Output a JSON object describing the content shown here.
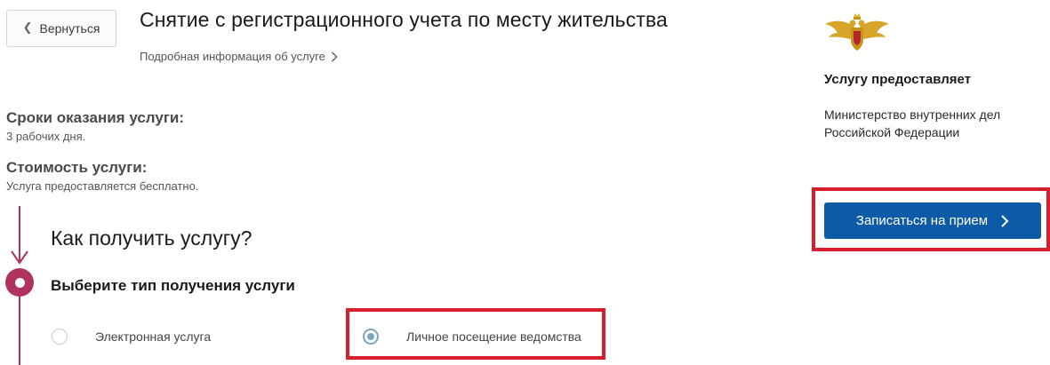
{
  "header": {
    "back_label": "Вернуться",
    "title": "Снятие с регистрационного учета по месту жительства",
    "info_link": "Подробная информация об услуге"
  },
  "terms": {
    "label": "Сроки оказания услуги:",
    "value": "3 рабочих дня."
  },
  "cost": {
    "label": "Стоимость услуги:",
    "value": "Услуга предоставляется бесплатно."
  },
  "how": {
    "title": "Как получить услугу?",
    "step_label": "Выберите тип получения услуги",
    "options": [
      {
        "label": "Электронная услуга",
        "selected": false
      },
      {
        "label": "Личное посещение ведомства",
        "selected": true
      }
    ]
  },
  "provider": {
    "emblem_icon": "russian-double-headed-eagle-emblem",
    "title": "Услугу предоставляет",
    "name": "Министерство внутренних дел Российской Федерации"
  },
  "actions": {
    "book_label": "Записаться на прием"
  },
  "colors": {
    "accent_magenta": "#b0325e",
    "primary_blue": "#0d5aa7",
    "highlight_red": "#d81e2c",
    "radio_blue": "#7aa6c2"
  }
}
